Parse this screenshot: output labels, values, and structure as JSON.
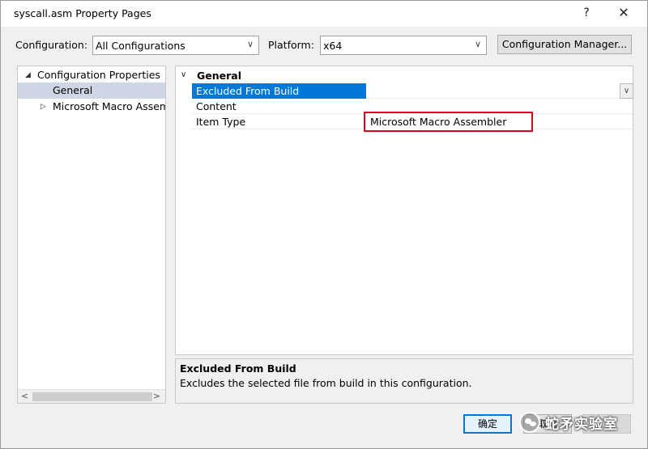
{
  "window": {
    "title": "syscall.asm Property Pages",
    "help": "?",
    "close": "✕"
  },
  "toolbar": {
    "configuration_label": "Configuration:",
    "configuration_value": "All Configurations",
    "platform_label": "Platform:",
    "platform_value": "x64",
    "config_manager_label": "Configuration Manager..."
  },
  "tree": {
    "items": [
      {
        "label": "Configuration Properties",
        "expanded": true
      },
      {
        "label": "General",
        "selected": true
      },
      {
        "label": "Microsoft Macro Assembler",
        "expanded": false
      }
    ]
  },
  "grid": {
    "category": "General",
    "rows": [
      {
        "name": "Excluded From Build",
        "value": "",
        "selected": true
      },
      {
        "name": "Content",
        "value": ""
      },
      {
        "name": "Item Type",
        "value": "Microsoft Macro Assembler"
      }
    ]
  },
  "description": {
    "title": "Excluded From Build",
    "text": "Excludes the selected file from build in this configuration."
  },
  "buttons": {
    "ok": "确定",
    "cancel": "取消",
    "apply": ""
  },
  "watermark": {
    "text": "蛇矛实验室"
  },
  "colors": {
    "selection": "#0078d7",
    "tree_selection": "#cfd6e5",
    "highlight_border": "#e0001b"
  }
}
